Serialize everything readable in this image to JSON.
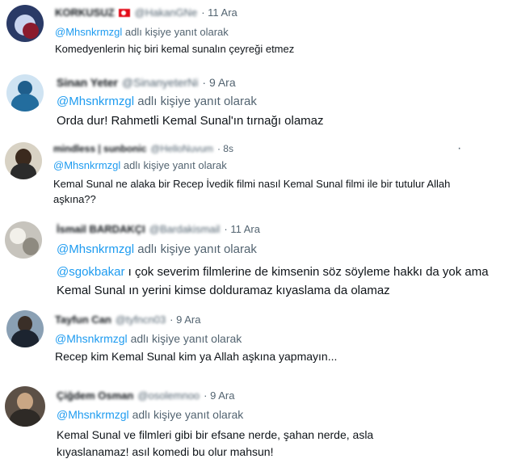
{
  "reply_text": "adlı kişiye yanıt olarak",
  "tweets": [
    {
      "name": "KORKUSUZ",
      "handle": "@HakanGNe",
      "time": "· 11 Ara",
      "reply_to": "@Mhsnkrmzgl",
      "text": "Komedyenlerin hiç biri kemal sunalın çeyreği etmez"
    },
    {
      "name": "Sinan Yeter",
      "handle": "@SinanyeterNi",
      "time": "· 9 Ara",
      "reply_to": "@Mhsnkrmzgl",
      "text": "Orda dur! Rahmetli Kemal Sunal'ın tırnağı olamaz"
    },
    {
      "name": "mindless | sunbonic",
      "handle": "@HelloNuvum",
      "time": "· 8s",
      "reply_to": "@Mhsnkrmzgl",
      "text": "Kemal Sunal ne alaka bir Recep İvedik filmi nasıl Kemal Sunal filmi ile bir tutulur Allah aşkına??"
    },
    {
      "name": "İsmail BARDAKÇI",
      "handle": "@Bardakismail",
      "time": "· 11 Ara",
      "reply_to": "@Mhsnkrmzgl",
      "mention": "@sgokbakar",
      "text": "ı çok severim filmlerine de kimsenin söz söyleme hakkı da yok ama Kemal Sunal ın yerini kimse dolduramaz kıyaslama da olamaz"
    },
    {
      "name": "Tayfun Can",
      "handle": "@tyfncn03",
      "time": "· 9 Ara",
      "reply_to": "@Mhsnkrmzgl",
      "text": "Recep kim Kemal Sunal kim ya Allah aşkına yapmayın..."
    },
    {
      "name": "Çiğdem Osman",
      "handle": "@osolemnoo",
      "time": "· 9 Ara",
      "reply_to": "@Mhsnkrmzgl",
      "text": "Kemal Sunal ve filmleri gibi bir efsane nerde, şahan nerde, asla kıyaslanamaz! asıl komedi bu olur mahsun!"
    }
  ],
  "more_icon": "·"
}
